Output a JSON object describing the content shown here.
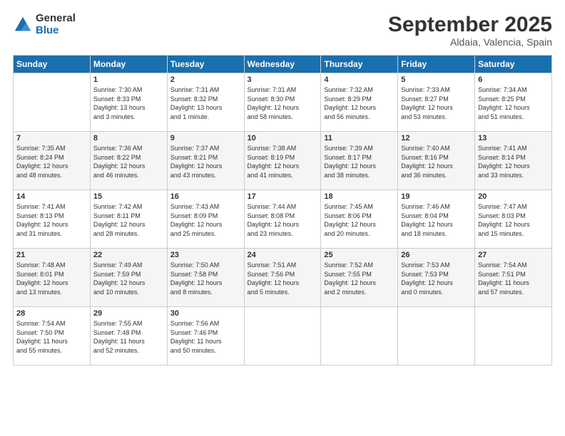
{
  "logo": {
    "general": "General",
    "blue": "Blue"
  },
  "title": "September 2025",
  "location": "Aldaia, Valencia, Spain",
  "weekdays": [
    "Sunday",
    "Monday",
    "Tuesday",
    "Wednesday",
    "Thursday",
    "Friday",
    "Saturday"
  ],
  "weeks": [
    [
      {
        "day": "",
        "info": ""
      },
      {
        "day": "1",
        "info": "Sunrise: 7:30 AM\nSunset: 8:33 PM\nDaylight: 13 hours\nand 3 minutes."
      },
      {
        "day": "2",
        "info": "Sunrise: 7:31 AM\nSunset: 8:32 PM\nDaylight: 13 hours\nand 1 minute."
      },
      {
        "day": "3",
        "info": "Sunrise: 7:31 AM\nSunset: 8:30 PM\nDaylight: 12 hours\nand 58 minutes."
      },
      {
        "day": "4",
        "info": "Sunrise: 7:32 AM\nSunset: 8:29 PM\nDaylight: 12 hours\nand 56 minutes."
      },
      {
        "day": "5",
        "info": "Sunrise: 7:33 AM\nSunset: 8:27 PM\nDaylight: 12 hours\nand 53 minutes."
      },
      {
        "day": "6",
        "info": "Sunrise: 7:34 AM\nSunset: 8:25 PM\nDaylight: 12 hours\nand 51 minutes."
      }
    ],
    [
      {
        "day": "7",
        "info": "Sunrise: 7:35 AM\nSunset: 8:24 PM\nDaylight: 12 hours\nand 48 minutes."
      },
      {
        "day": "8",
        "info": "Sunrise: 7:36 AM\nSunset: 8:22 PM\nDaylight: 12 hours\nand 46 minutes."
      },
      {
        "day": "9",
        "info": "Sunrise: 7:37 AM\nSunset: 8:21 PM\nDaylight: 12 hours\nand 43 minutes."
      },
      {
        "day": "10",
        "info": "Sunrise: 7:38 AM\nSunset: 8:19 PM\nDaylight: 12 hours\nand 41 minutes."
      },
      {
        "day": "11",
        "info": "Sunrise: 7:39 AM\nSunset: 8:17 PM\nDaylight: 12 hours\nand 38 minutes."
      },
      {
        "day": "12",
        "info": "Sunrise: 7:40 AM\nSunset: 8:16 PM\nDaylight: 12 hours\nand 36 minutes."
      },
      {
        "day": "13",
        "info": "Sunrise: 7:41 AM\nSunset: 8:14 PM\nDaylight: 12 hours\nand 33 minutes."
      }
    ],
    [
      {
        "day": "14",
        "info": "Sunrise: 7:41 AM\nSunset: 8:13 PM\nDaylight: 12 hours\nand 31 minutes."
      },
      {
        "day": "15",
        "info": "Sunrise: 7:42 AM\nSunset: 8:11 PM\nDaylight: 12 hours\nand 28 minutes."
      },
      {
        "day": "16",
        "info": "Sunrise: 7:43 AM\nSunset: 8:09 PM\nDaylight: 12 hours\nand 25 minutes."
      },
      {
        "day": "17",
        "info": "Sunrise: 7:44 AM\nSunset: 8:08 PM\nDaylight: 12 hours\nand 23 minutes."
      },
      {
        "day": "18",
        "info": "Sunrise: 7:45 AM\nSunset: 8:06 PM\nDaylight: 12 hours\nand 20 minutes."
      },
      {
        "day": "19",
        "info": "Sunrise: 7:46 AM\nSunset: 8:04 PM\nDaylight: 12 hours\nand 18 minutes."
      },
      {
        "day": "20",
        "info": "Sunrise: 7:47 AM\nSunset: 8:03 PM\nDaylight: 12 hours\nand 15 minutes."
      }
    ],
    [
      {
        "day": "21",
        "info": "Sunrise: 7:48 AM\nSunset: 8:01 PM\nDaylight: 12 hours\nand 13 minutes."
      },
      {
        "day": "22",
        "info": "Sunrise: 7:49 AM\nSunset: 7:59 PM\nDaylight: 12 hours\nand 10 minutes."
      },
      {
        "day": "23",
        "info": "Sunrise: 7:50 AM\nSunset: 7:58 PM\nDaylight: 12 hours\nand 8 minutes."
      },
      {
        "day": "24",
        "info": "Sunrise: 7:51 AM\nSunset: 7:56 PM\nDaylight: 12 hours\nand 5 minutes."
      },
      {
        "day": "25",
        "info": "Sunrise: 7:52 AM\nSunset: 7:55 PM\nDaylight: 12 hours\nand 2 minutes."
      },
      {
        "day": "26",
        "info": "Sunrise: 7:53 AM\nSunset: 7:53 PM\nDaylight: 12 hours\nand 0 minutes."
      },
      {
        "day": "27",
        "info": "Sunrise: 7:54 AM\nSunset: 7:51 PM\nDaylight: 11 hours\nand 57 minutes."
      }
    ],
    [
      {
        "day": "28",
        "info": "Sunrise: 7:54 AM\nSunset: 7:50 PM\nDaylight: 11 hours\nand 55 minutes."
      },
      {
        "day": "29",
        "info": "Sunrise: 7:55 AM\nSunset: 7:48 PM\nDaylight: 11 hours\nand 52 minutes."
      },
      {
        "day": "30",
        "info": "Sunrise: 7:56 AM\nSunset: 7:46 PM\nDaylight: 11 hours\nand 50 minutes."
      },
      {
        "day": "",
        "info": ""
      },
      {
        "day": "",
        "info": ""
      },
      {
        "day": "",
        "info": ""
      },
      {
        "day": "",
        "info": ""
      }
    ]
  ]
}
